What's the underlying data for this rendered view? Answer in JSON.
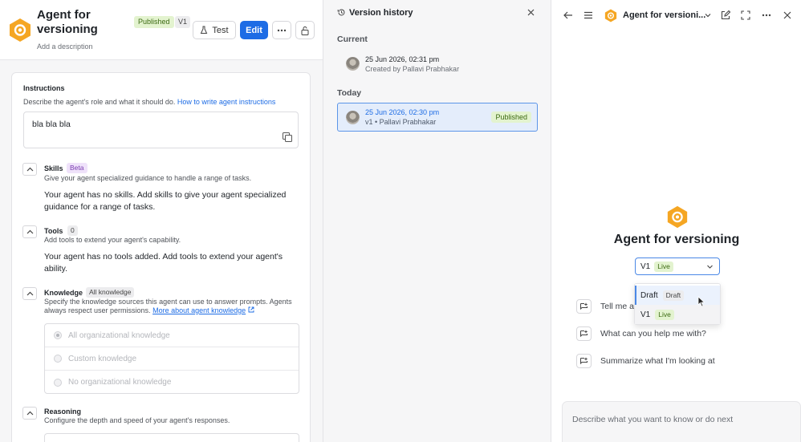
{
  "agent": {
    "title": "Agent for versioning",
    "description_placeholder": "Add a description",
    "status_badge": "Published",
    "version_badge": "V1"
  },
  "toolbar": {
    "test_label": "Test",
    "edit_label": "Edit"
  },
  "instructions": {
    "title": "Instructions",
    "subtitle": "Describe the agent's role and what it should do.",
    "help_link": "How to write agent instructions",
    "value": "bla bla bla"
  },
  "skills": {
    "title": "Skills",
    "tag": "Beta",
    "subtitle": "Give your agent specialized guidance to handle a range of tasks.",
    "empty": "Your agent has no skills. Add skills to give your agent specialized guidance for a range of tasks."
  },
  "tools": {
    "title": "Tools",
    "count": "0",
    "subtitle": "Add tools to extend your agent's capability.",
    "empty": "Your agent has no tools added. Add tools to extend your agent's ability."
  },
  "knowledge": {
    "title": "Knowledge",
    "tag": "All knowledge",
    "subtitle": "Specify the knowledge sources this agent can use to answer prompts. Agents always respect user permissions.",
    "link": "More about agent knowledge",
    "options": [
      {
        "label": "All organizational knowledge",
        "selected": true
      },
      {
        "label": "Custom knowledge",
        "selected": false
      },
      {
        "label": "No organizational knowledge",
        "selected": false
      }
    ]
  },
  "reasoning": {
    "title": "Reasoning",
    "subtitle": "Configure the depth and speed of your agent's responses."
  },
  "version_history": {
    "title": "Version history",
    "current_label": "Current",
    "current": {
      "date": "25 Jun 2026, 02:31 pm",
      "by": "Created by Pallavi Prabhakar"
    },
    "today_label": "Today",
    "today": {
      "date": "25 Jun 2026, 02:30 pm",
      "by": "v1 • Pallavi Prabhakar",
      "badge": "Published"
    }
  },
  "preview": {
    "header_title": "Agent for versioni...",
    "agent_name": "Agent for versioning",
    "selected_version": "V1",
    "selected_tag": "Live",
    "dropdown": [
      {
        "label": "Draft",
        "tag": "Draft"
      },
      {
        "label": "V1",
        "tag": "Live"
      }
    ],
    "suggestions": [
      "Tell me ab",
      "What can you help me with?",
      "Summarize what I'm looking at"
    ],
    "prompt_placeholder": "Describe what you want to know or do next"
  },
  "colors": {
    "accent": "#1d6ce5",
    "published_bg": "#e3f3cf",
    "logo": "#f5a623"
  }
}
